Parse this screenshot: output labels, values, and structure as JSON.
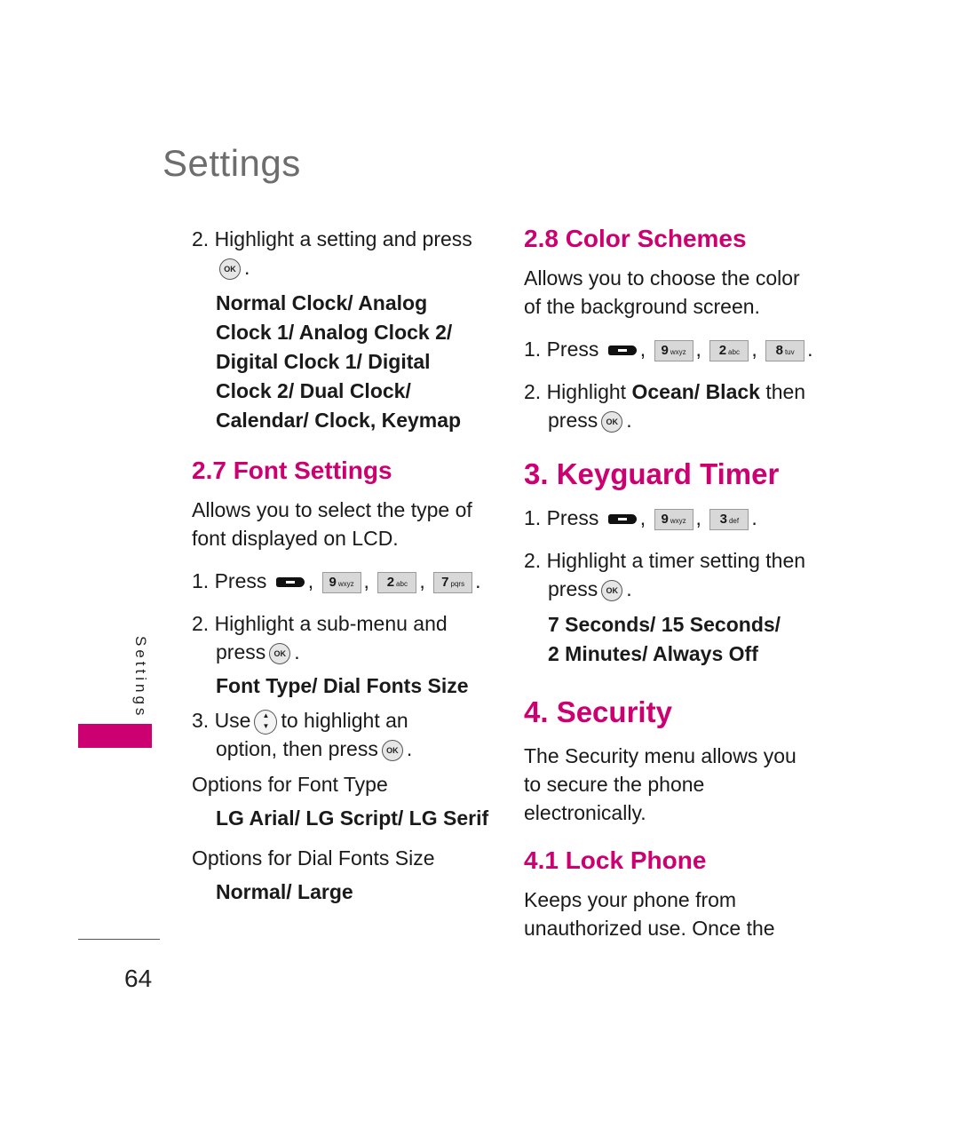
{
  "page": {
    "title": "Settings",
    "side_tab": "Settings",
    "page_number": "64",
    "accent_color": "#cc0070"
  },
  "left": {
    "step2_text": "2. Highlight a setting and press",
    "clock_options": "Normal Clock/ Analog Clock 1/ Analog Clock 2/ Digital Clock 1/ Digital Clock 2/ Dual Clock/ Calendar/ Clock, Keymap",
    "font_settings": {
      "heading": "2.7 Font Settings",
      "desc": "Allows you to select the type of font displayed on LCD.",
      "step1": "1. Press",
      "keys": [
        {
          "num": "9",
          "letters": "wxyz"
        },
        {
          "num": "2",
          "letters": "abc"
        },
        {
          "num": "7",
          "letters": "pqrs"
        }
      ],
      "step2a": "2. Highlight a sub-menu and",
      "step2b": "press",
      "submenus": "Font Type/ Dial Fonts Size",
      "step3a": "3. Use",
      "step3b": "to highlight an",
      "step3c": "option, then press",
      "font_type_label": "Options for Font Type",
      "font_type_values": "LG Arial/ LG Script/ LG Serif",
      "dial_size_label": "Options for Dial Fonts Size",
      "dial_size_values": "Normal/ Large"
    }
  },
  "right": {
    "color_schemes": {
      "heading": "2.8 Color Schemes",
      "desc": "Allows you to choose the color of the background screen.",
      "step1": "1. Press",
      "keys": [
        {
          "num": "9",
          "letters": "wxyz"
        },
        {
          "num": "2",
          "letters": "abc"
        },
        {
          "num": "8",
          "letters": "tuv"
        }
      ],
      "step2_prefix": "2. Highlight",
      "step2_bold": "Ocean/ Black",
      "step2_suffix": "then",
      "step2_press": "press"
    },
    "keyguard": {
      "heading": "3. Keyguard Timer",
      "step1": "1. Press",
      "keys": [
        {
          "num": "9",
          "letters": "wxyz"
        },
        {
          "num": "3",
          "letters": "def"
        }
      ],
      "step2": "2. Highlight a timer setting then",
      "step2_press": "press",
      "options_line1": "7 Seconds/ 15 Seconds/",
      "options_line2": "2 Minutes/ Always Off"
    },
    "security": {
      "heading": "4. Security",
      "desc": "The Security menu allows you to secure the phone electronically."
    },
    "lock_phone": {
      "heading": "4.1 Lock Phone",
      "desc": "Keeps your phone from unauthorized use. Once the"
    }
  },
  "icons": {
    "ok": "OK",
    "nav": "▲▼"
  }
}
